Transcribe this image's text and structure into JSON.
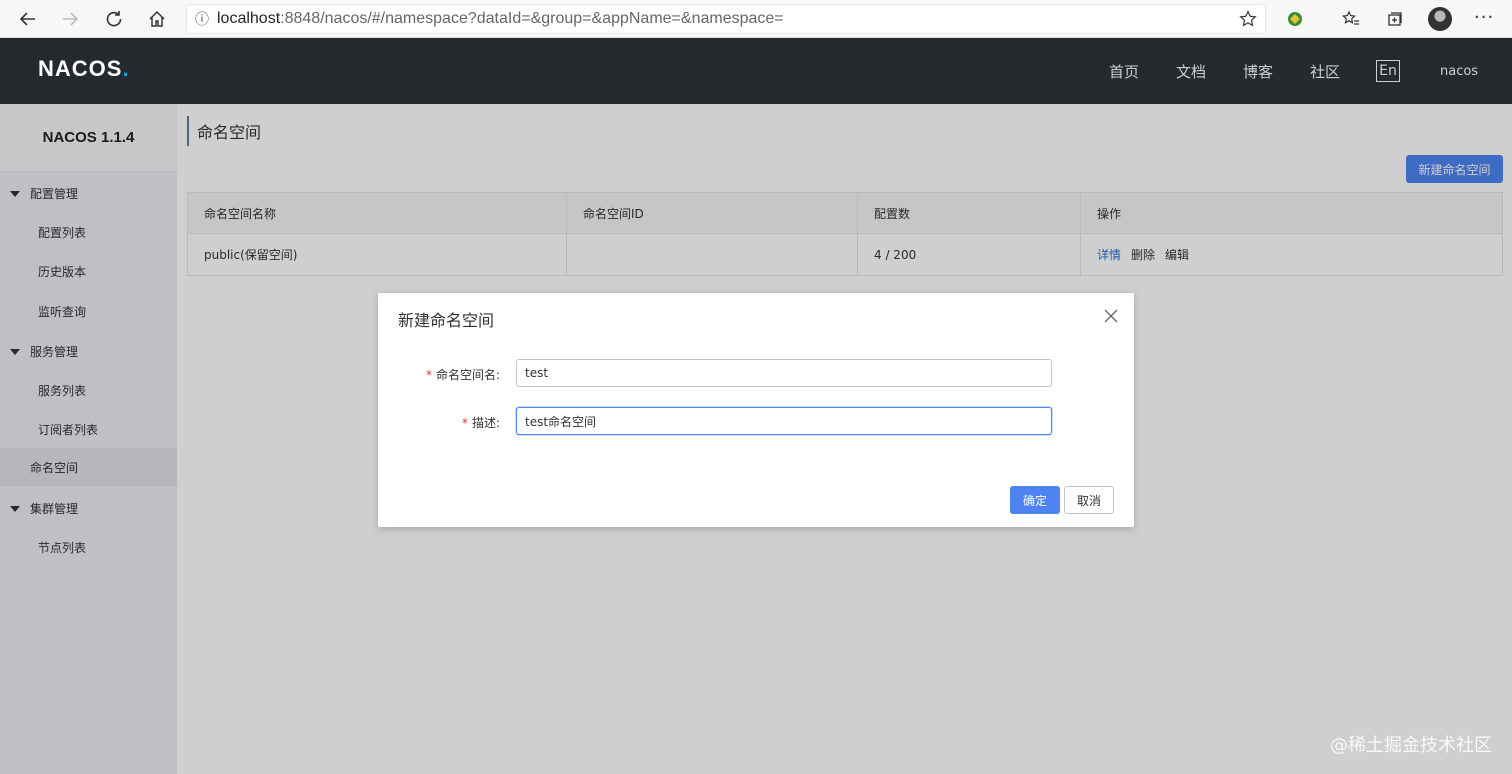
{
  "browser": {
    "url_host": "localhost",
    "url_rest": ":8848/nacos/#/namespace?dataId=&group=&appName=&namespace="
  },
  "header": {
    "logo": "NACOS",
    "logo_dot": ".",
    "nav": [
      "首页",
      "文档",
      "博客",
      "社区"
    ],
    "lang": "En",
    "user": "nacos"
  },
  "sidebar": {
    "version": "NACOS 1.1.4",
    "groups": [
      {
        "label": "配置管理",
        "items": [
          "配置列表",
          "历史版本",
          "监听查询"
        ]
      },
      {
        "label": "服务管理",
        "items": [
          "服务列表",
          "订阅者列表"
        ]
      },
      {
        "label": "命名空间",
        "items": []
      },
      {
        "label": "集群管理",
        "items": [
          "节点列表"
        ]
      }
    ]
  },
  "main": {
    "title": "命名空间",
    "new_button": "新建命名空间",
    "table": {
      "headers": [
        "命名空间名称",
        "命名空间ID",
        "配置数",
        "操作"
      ],
      "rows": [
        {
          "name": "public(保留空间)",
          "id": "",
          "count": "4 / 200",
          "actions": [
            "详情",
            "删除",
            "编辑"
          ]
        }
      ]
    }
  },
  "dialog": {
    "title": "新建命名空间",
    "fields": [
      {
        "label": "命名空间名:",
        "required": "*",
        "value": "test"
      },
      {
        "label": "描述:",
        "required": "*",
        "value": "test命名空间"
      }
    ],
    "ok": "确定",
    "cancel": "取消"
  },
  "watermark": "@稀土掘金技术社区"
}
